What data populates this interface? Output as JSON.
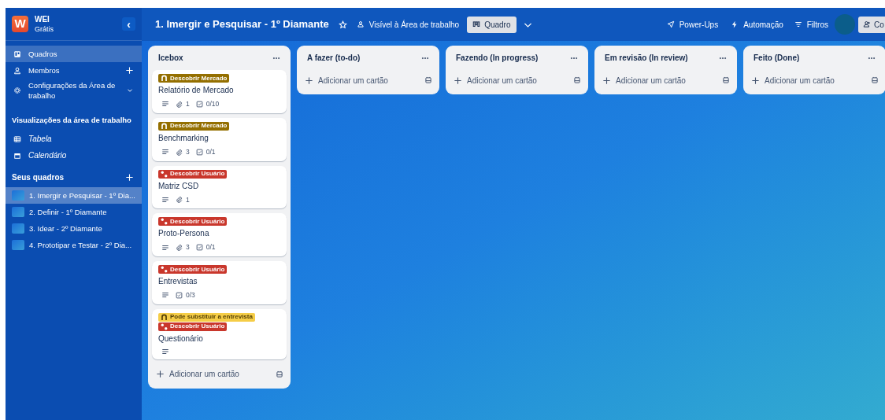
{
  "workspace": {
    "initial": "W",
    "name": "WEI",
    "plan": "Grátis",
    "collapse": "‹"
  },
  "sidebar": {
    "items": [
      {
        "kind": "boards",
        "label": "Quadros",
        "selected": true
      },
      {
        "kind": "members",
        "label": "Membros",
        "selected": false
      },
      {
        "kind": "settings",
        "label": "Configurações da Área de trabalho",
        "selected": false
      }
    ],
    "views_heading": "Visualizações da área de trabalho",
    "views": [
      {
        "kind": "table",
        "label": "Tabela"
      },
      {
        "kind": "calendar",
        "label": "Calendário"
      }
    ],
    "boards_heading": "Seus quadros",
    "boards": [
      {
        "label": "1. Imergir e Pesquisar - 1º Dia...",
        "selected": true
      },
      {
        "label": "2. Definir - 1º Diamante",
        "selected": false
      },
      {
        "label": "3. Idear - 2º Diamante",
        "selected": false
      },
      {
        "label": "4. Prototipar e Testar - 2º Dia...",
        "selected": false
      }
    ]
  },
  "header": {
    "title": "1. Imergir e Pesquisar - 1º Diamante",
    "visibility": "Visível à Área de trabalho",
    "view": "Quadro",
    "powerups": "Power-Ups",
    "automation": "Automação",
    "filters": "Filtros",
    "share": "Co"
  },
  "lists": [
    {
      "title": "Icebox",
      "add": "Adicionar um cartão",
      "cards": [
        {
          "labels": [
            {
              "kind": "arch",
              "text": "Descobrir Mercado",
              "color": "#946f00"
            }
          ],
          "title": "Relatório de Mercado",
          "badges": [
            {
              "kind": "description"
            },
            {
              "kind": "attachment",
              "text": "1"
            },
            {
              "kind": "checklist",
              "text": "0/10"
            }
          ]
        },
        {
          "labels": [
            {
              "kind": "arch",
              "text": "Descobrir Mercado",
              "color": "#946f00"
            }
          ],
          "title": "Benchmarking",
          "badges": [
            {
              "kind": "description"
            },
            {
              "kind": "attachment",
              "text": "3"
            },
            {
              "kind": "checklist",
              "text": "0/1"
            }
          ]
        },
        {
          "labels": [
            {
              "kind": "dots",
              "text": "Descobrir Usuário",
              "color": "#c9372c"
            }
          ],
          "title": "Matriz CSD",
          "badges": [
            {
              "kind": "description"
            },
            {
              "kind": "attachment",
              "text": "1"
            }
          ]
        },
        {
          "labels": [
            {
              "kind": "dots",
              "text": "Descobrir Usuário",
              "color": "#c9372c"
            }
          ],
          "title": "Proto-Persona",
          "badges": [
            {
              "kind": "description"
            },
            {
              "kind": "attachment",
              "text": "3"
            },
            {
              "kind": "checklist",
              "text": "0/1"
            }
          ]
        },
        {
          "labels": [
            {
              "kind": "dots",
              "text": "Descobrir Usuário",
              "color": "#c9372c"
            }
          ],
          "title": "Entrevistas",
          "badges": [
            {
              "kind": "description"
            },
            {
              "kind": "checklist",
              "text": "0/3"
            }
          ]
        },
        {
          "labels": [
            {
              "kind": "arch",
              "text": "Pode substituir a entrevista",
              "color": "#f5cd47"
            },
            {
              "kind": "dots",
              "text": "Descobrir Usuário",
              "color": "#c9372c"
            }
          ],
          "title": "Questionário",
          "badges": [
            {
              "kind": "description"
            }
          ]
        }
      ]
    },
    {
      "title": "A fazer (to-do)",
      "add": "Adicionar um cartão"
    },
    {
      "title": "Fazendo (In progress)",
      "add": "Adicionar um cartão"
    },
    {
      "title": "Em revisão (In review)",
      "add": "Adicionar um cartão"
    },
    {
      "title": "Feito (Done)",
      "add": "Adicionar um cartão"
    }
  ]
}
